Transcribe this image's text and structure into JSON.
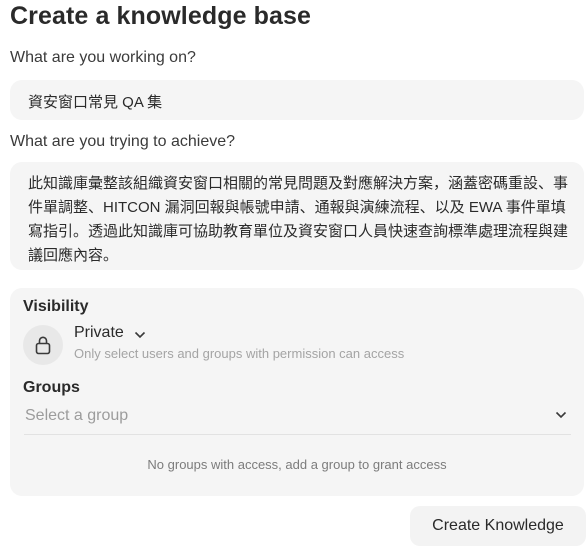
{
  "page": {
    "title": "Create a knowledge base"
  },
  "name_field": {
    "label": "What are you working on?",
    "value": "資安窗口常見 QA 集"
  },
  "goal_field": {
    "label": "What are you trying to achieve?",
    "value": "此知識庫彙整該組織資安窗口相關的常見問題及對應解決方案，涵蓋密碼重設、事件單調整、HITCON 漏洞回報與帳號申請、通報與演練流程、以及 EWA 事件單填寫指引。透過此知識庫可協助教育單位及資安窗口人員快速查詢標準處理流程與建議回應內容。"
  },
  "visibility": {
    "heading": "Visibility",
    "icon": "lock-icon",
    "value": "Private",
    "description": "Only select users and groups with permission can access"
  },
  "groups": {
    "heading": "Groups",
    "placeholder": "Select a group",
    "empty_message": "No groups with access, add a group to grant access"
  },
  "actions": {
    "create_label": "Create Knowledge"
  }
}
